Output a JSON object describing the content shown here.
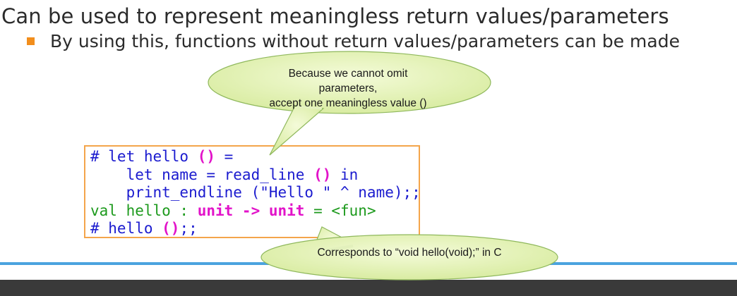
{
  "slide": {
    "heading": "Can be used to represent meaningless return values/parameters",
    "bullet": "By using this, functions without return values/parameters can be made"
  },
  "code": {
    "lines": [
      [
        {
          "t": "# let hello ",
          "c": "blue"
        },
        {
          "t": "()",
          "c": "magenta"
        },
        {
          "t": " =",
          "c": "blue"
        }
      ],
      [
        {
          "t": "    let name = read_line ",
          "c": "blue"
        },
        {
          "t": "()",
          "c": "magenta"
        },
        {
          "t": " in",
          "c": "blue"
        }
      ],
      [
        {
          "t": "    print_endline (\"Hello \" ^ name);;",
          "c": "blue"
        }
      ],
      [
        {
          "t": "val hello : ",
          "c": "green"
        },
        {
          "t": "unit -> unit",
          "c": "magenta"
        },
        {
          "t": " = <fun>",
          "c": "green"
        }
      ],
      [
        {
          "t": "# hello ",
          "c": "blue"
        },
        {
          "t": "()",
          "c": "magenta"
        },
        {
          "t": ";;",
          "c": "blue"
        }
      ]
    ]
  },
  "callouts": {
    "params_line1": "Because we cannot omit parameters,",
    "params_line2": "accept one meaningless value ()",
    "c_equivalent": "Corresponds to “void hello(void);” in C"
  },
  "colors": {
    "bullet": "#f28e1c",
    "code_border": "#f4a54b",
    "keyword_blue": "#1b1bcf",
    "response_green": "#1d9a1d",
    "unit_magenta": "#e213c9",
    "bottom_bar": "#4ba3df",
    "callout_fill": "#e6f3b5",
    "callout_stroke": "#8fb85c"
  }
}
